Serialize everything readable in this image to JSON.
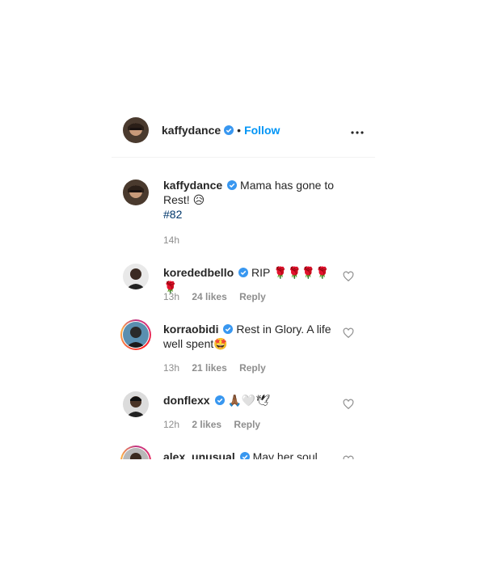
{
  "post": {
    "author": "kaffydance",
    "follow_label": "Follow",
    "dot": "•",
    "more_icon": "more-horizontal-icon"
  },
  "caption": {
    "username": "kaffydance",
    "text": "Mama has gone to Rest! 😥",
    "hashtag": "#82",
    "time": "14h"
  },
  "comments": [
    {
      "username": "korededbello",
      "text": "RIP 🌹🌹🌹🌹🌹",
      "time": "13h",
      "likes": "24 likes",
      "reply": "Reply"
    },
    {
      "username": "korraobidi",
      "text": "Rest in Glory. A life well spent🤩",
      "time": "13h",
      "likes": "21 likes",
      "reply": "Reply"
    },
    {
      "username": "donflexx",
      "text": "🙏🏾🤍🕊",
      "time": "12h",
      "likes": "2 likes",
      "reply": "Reply"
    },
    {
      "username": "alex_unusual",
      "text": "May her soul"
    }
  ],
  "colors": {
    "accent": "#0095f6",
    "verified": "#3897f0",
    "meta": "#8e8e8e",
    "hashtag": "#00376b"
  }
}
